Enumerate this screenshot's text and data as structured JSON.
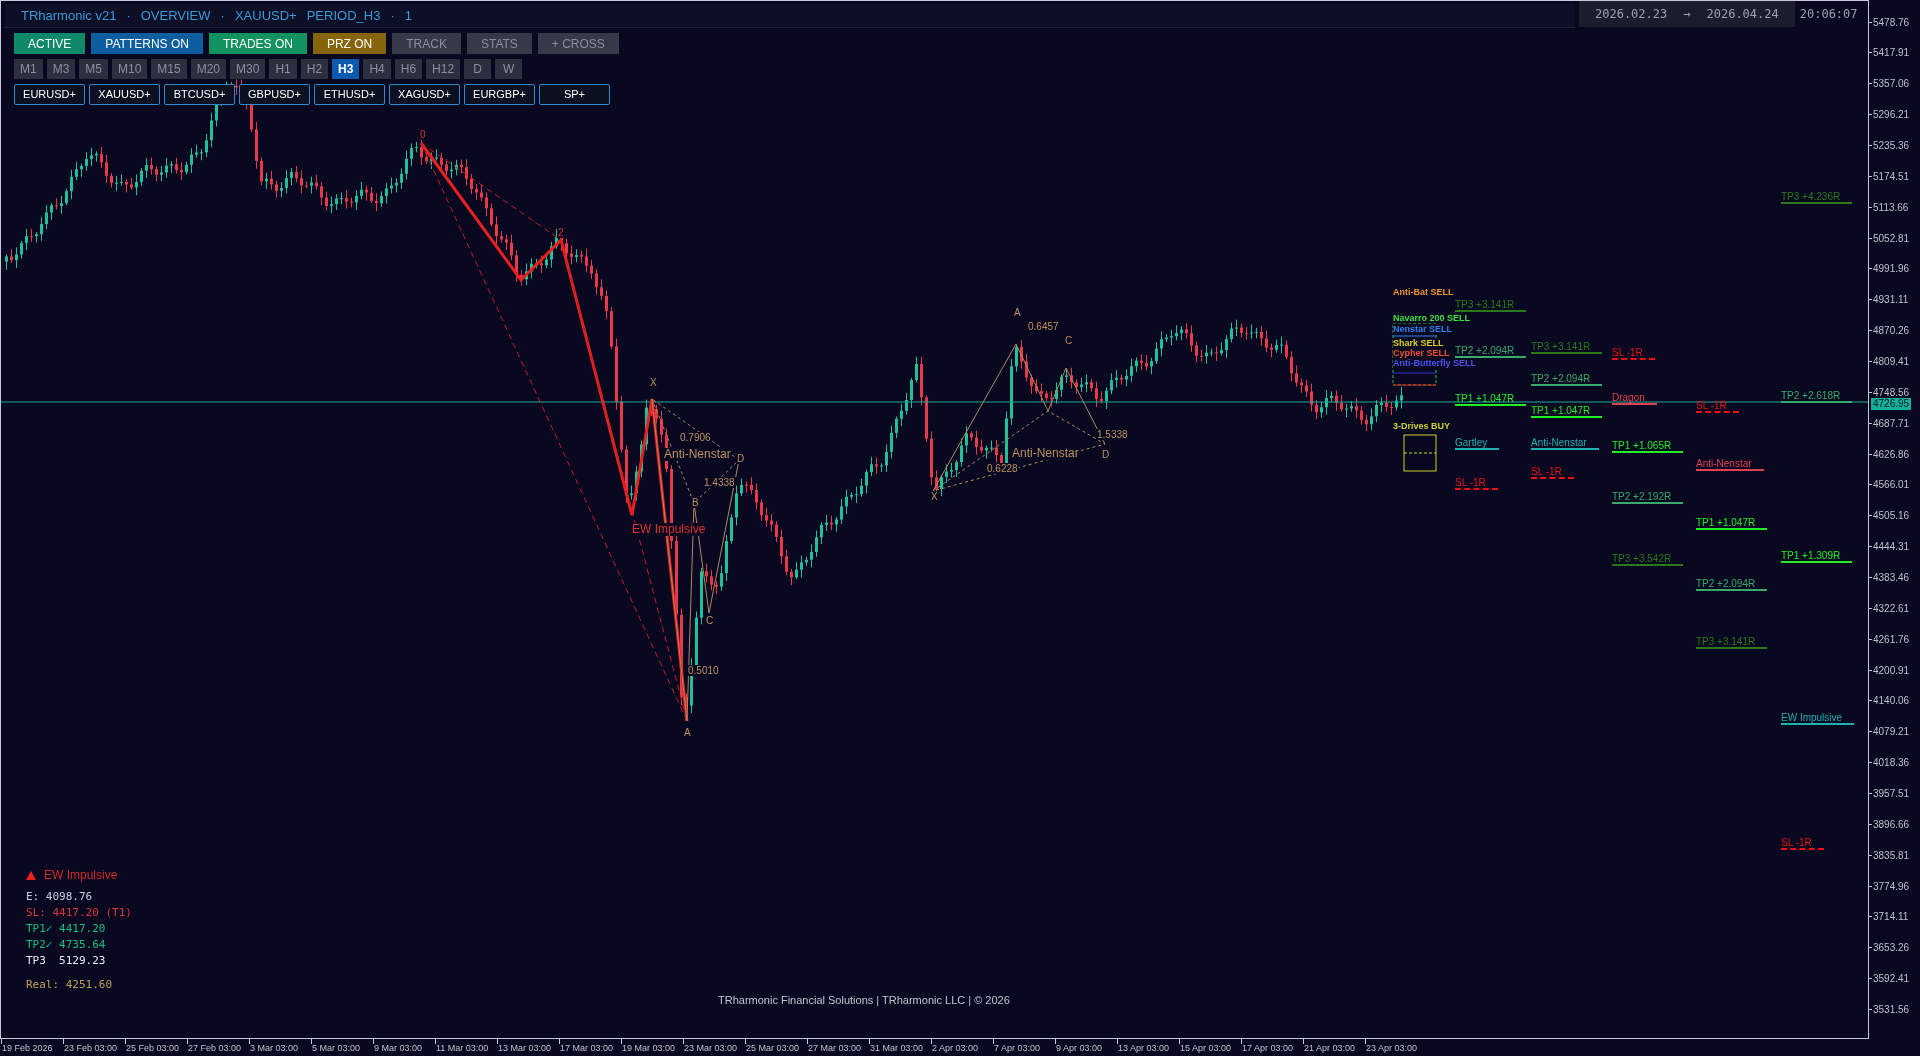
{
  "header": {
    "title_parts": [
      "TRharmonic v21",
      "·",
      "OVERVIEW",
      "·",
      "XAUUSD+",
      "PERIOD_H3",
      "·",
      "1"
    ],
    "date_from": "2026.02.23",
    "arrow": "→",
    "date_to": "2026.04.24",
    "time": "20:06:07"
  },
  "toggles": [
    {
      "label": "ACTIVE",
      "on": true,
      "color": "#0e8a6a"
    },
    {
      "label": "PATTERNS ON",
      "on": true,
      "color": "#0d5e9e"
    },
    {
      "label": "TRADES ON",
      "on": true,
      "color": "#12925f"
    },
    {
      "label": "PRZ ON",
      "on": true,
      "color": "#86640a"
    },
    {
      "label": "TRACK",
      "on": false
    },
    {
      "label": "STATS",
      "on": false
    },
    {
      "label": "+ CROSS",
      "on": false
    }
  ],
  "timeframes": [
    {
      "label": "M1",
      "selected": false
    },
    {
      "label": "M3",
      "selected": false
    },
    {
      "label": "M5",
      "selected": false
    },
    {
      "label": "M10",
      "selected": false
    },
    {
      "label": "M15",
      "selected": false
    },
    {
      "label": "M20",
      "selected": false
    },
    {
      "label": "M30",
      "selected": false
    },
    {
      "label": "H1",
      "selected": false
    },
    {
      "label": "H2",
      "selected": false
    },
    {
      "label": "H3",
      "selected": true
    },
    {
      "label": "H4",
      "selected": false
    },
    {
      "label": "H6",
      "selected": false
    },
    {
      "label": "H12",
      "selected": false
    },
    {
      "label": "D",
      "selected": false
    },
    {
      "label": "W",
      "selected": false
    }
  ],
  "symbols": [
    "EURUSD+",
    "XAUUSD+",
    "BTCUSD+",
    "GBPUSD+",
    "ETHUSD+",
    "XAGUSD+",
    "EURGBP+",
    "SP+"
  ],
  "price_axis": [
    "5478.76",
    "5417.91",
    "5357.06",
    "5296.21",
    "5235.36",
    "5174.51",
    "5113.66",
    "5052.81",
    "4991.96",
    "4931.11",
    "4870.26",
    "4809.41",
    "4748.56",
    "4687.71",
    "4626.86",
    "4566.01",
    "4505.16",
    "4444.31",
    "4383.46",
    "4322.61",
    "4261.76",
    "4200.91",
    "4140.06",
    "4079.21",
    "4018.36",
    "3957.51",
    "3896.66",
    "3835.81",
    "3774.96",
    "3714.11",
    "3653.26",
    "3592.41",
    "3531.56"
  ],
  "current_price": "4726.95",
  "time_axis": [
    "19 Feb 2026",
    "23 Feb 03:00",
    "25 Feb 03:00",
    "27 Feb 03:00",
    "3 Mar 03:00",
    "5 Mar 03:00",
    "9 Mar 03:00",
    "11 Mar 03:00",
    "13 Mar 03:00",
    "17 Mar 03:00",
    "19 Mar 03:00",
    "23 Mar 03:00",
    "25 Mar 03:00",
    "27 Mar 03:00",
    "31 Mar 03:00",
    "2 Apr 03:00",
    "7 Apr 03:00",
    "9 Apr 03:00",
    "13 Apr 03:00",
    "15 Apr 03:00",
    "17 Apr 03:00",
    "21 Apr 03:00",
    "23 Apr 03:00"
  ],
  "annotations": [
    {
      "text": "0",
      "kind": "wave"
    },
    {
      "text": "2",
      "kind": "wave"
    },
    {
      "text": "EW Impulsive",
      "kind": "wave"
    },
    {
      "text": "X",
      "kind": "harmonic"
    },
    {
      "text": "0.7906",
      "kind": "harmonic"
    },
    {
      "text": "Anti-Nenstar",
      "kind": "harmonic"
    },
    {
      "text": "1.4338",
      "kind": "harmonic"
    },
    {
      "text": "D",
      "kind": "harmonic"
    },
    {
      "text": "B",
      "kind": "harmonic"
    },
    {
      "text": "C",
      "kind": "harmonic"
    },
    {
      "text": "0.5010",
      "kind": "harmonic"
    },
    {
      "text": "A",
      "kind": "harmonic"
    },
    {
      "text": "A",
      "kind": "harmonic"
    },
    {
      "text": "0.6457",
      "kind": "harmonic"
    },
    {
      "text": "C",
      "kind": "harmonic"
    },
    {
      "text": "X",
      "kind": "harmonic"
    },
    {
      "text": "0.6228",
      "kind": "harmonic"
    },
    {
      "text": "Anti-Nenstar",
      "kind": "harmonic"
    },
    {
      "text": "1.5338",
      "kind": "harmonic"
    },
    {
      "text": "D",
      "kind": "harmonic"
    }
  ],
  "pattern_labels": [
    {
      "text": "Anti-Bat SELL",
      "color": "#f09030"
    },
    {
      "text": "Navarro 200 SELL",
      "color": "#40e040"
    },
    {
      "text": "Nenstar SELL",
      "color": "#3080f0"
    },
    {
      "text": "Shark SELL",
      "color": "#e0d020"
    },
    {
      "text": "Cypher SELL",
      "color": "#f05030"
    },
    {
      "text": "Anti-Butterfly SELL",
      "color": "#5050f0"
    },
    {
      "text": "3-Drives BUY",
      "color": "#d0d030"
    }
  ],
  "trade_columns": [
    {
      "levels": [
        {
          "text": "TP3 +3.141R",
          "kind": "tp",
          "color": "#2a7a1a"
        },
        {
          "text": "TP2 +2.094R",
          "kind": "tp",
          "color": "#3aaa6a"
        },
        {
          "text": "TP1 +1.047R",
          "kind": "tp",
          "color": "#22ee22"
        },
        {
          "text": "Gartley",
          "kind": "name",
          "color": "#20b0b0"
        },
        {
          "text": "SL -1R",
          "kind": "sl",
          "color": "#ee1111"
        }
      ]
    },
    {
      "levels": [
        {
          "text": "TP3 +3.141R",
          "kind": "tp",
          "color": "#2a7a1a"
        },
        {
          "text": "TP2 +2.094R",
          "kind": "tp",
          "color": "#3aaa6a"
        },
        {
          "text": "TP1 +1.047R",
          "kind": "tp",
          "color": "#22ee22"
        },
        {
          "text": "Anti-Nenstar",
          "kind": "name",
          "color": "#20b0b0"
        },
        {
          "text": "SL -1R",
          "kind": "sl",
          "color": "#ee1111"
        }
      ]
    },
    {
      "levels": [
        {
          "text": "SL -1R",
          "kind": "sl",
          "color": "#ee1111"
        },
        {
          "text": "Dragon",
          "kind": "name",
          "color": "#e04050"
        },
        {
          "text": "TP1 +1.065R",
          "kind": "tp",
          "color": "#22ee22"
        },
        {
          "text": "TP2 +2.192R",
          "kind": "tp",
          "color": "#3aaa6a"
        },
        {
          "text": "TP3 +3.542R",
          "kind": "tp",
          "color": "#2a7a1a"
        }
      ]
    },
    {
      "levels": [
        {
          "text": "SL -1R",
          "kind": "sl",
          "color": "#ee1111"
        },
        {
          "text": "Anti-Nenstar",
          "kind": "name",
          "color": "#e04050"
        },
        {
          "text": "TP1 +1.047R",
          "kind": "tp",
          "color": "#22ee22"
        },
        {
          "text": "TP2 +2.094R",
          "kind": "tp",
          "color": "#3aaa6a"
        },
        {
          "text": "TP3 +3.141R",
          "kind": "tp",
          "color": "#2a7a1a"
        }
      ]
    },
    {
      "levels": [
        {
          "text": "TP3 +4.236R",
          "kind": "tp",
          "color": "#2a7a1a"
        },
        {
          "text": "TP2 +2.618R",
          "kind": "tp",
          "color": "#3aaa6a"
        },
        {
          "text": "TP1 +1.309R",
          "kind": "tp",
          "color": "#22ee22"
        },
        {
          "text": "EW Impulsive",
          "kind": "name",
          "color": "#20b0b0"
        },
        {
          "text": "SL -1R",
          "kind": "sl",
          "color": "#ee1111"
        }
      ]
    }
  ],
  "info_panel": {
    "title": "EW Impulsive",
    "lines": [
      {
        "text": "E: 4098.76",
        "color": "#c8d0e0"
      },
      {
        "text": "SL: 4417.20 (T1)",
        "color": "#d83838"
      },
      {
        "text": "TP1✓ 4417.20",
        "color": "#10c080"
      },
      {
        "text": "TP2✓ 4735.64",
        "color": "#10c080"
      },
      {
        "text": "TP3  5129.23",
        "color": "#e8ecf4"
      },
      {
        "text": "Real: 4251.60",
        "color": "#c0a050"
      }
    ]
  },
  "footer": "TRharmonic Financial Solutions | TRharmonic LLC | © 2026"
}
